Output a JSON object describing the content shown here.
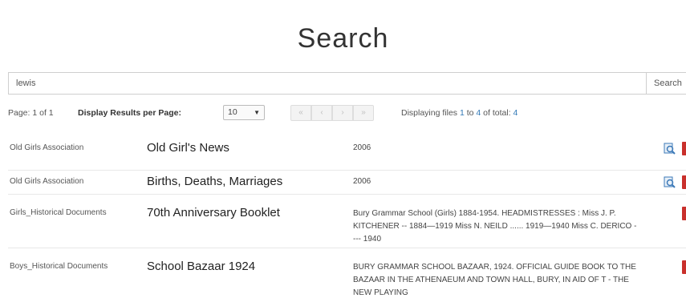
{
  "header": {
    "title": "Search"
  },
  "search": {
    "value": "lewis",
    "button_label": "Search"
  },
  "pagination": {
    "page_info": "Page: 1 of 1",
    "per_page_label": "Display Results per Page:",
    "per_page_value": "10",
    "first": "«",
    "prev": "‹",
    "next": "›",
    "last": "»",
    "displaying_prefix": "Displaying files",
    "displaying_from": "1",
    "displaying_to_word": "to",
    "displaying_to": "4",
    "displaying_of": "of total:",
    "displaying_total": "4"
  },
  "results": [
    {
      "category": "Old Girls Association",
      "title": "Old Girl's News",
      "description": "2006",
      "has_view": true,
      "has_pdf": true
    },
    {
      "category": "Old Girls Association",
      "title": "Births, Deaths, Marriages",
      "description": "2006",
      "has_view": true,
      "has_pdf": true
    },
    {
      "category": "Girls_Historical Documents",
      "title": "70th Anniversary Booklet",
      "description": "Bury Grammar School (Girls) 1884-1954. HEADMISTRESSES : Miss J. P. KITCHENER -- 1884—1919 Miss N. NEILD ...... 1919—1940 Miss C. DERICO ---- 1940",
      "has_view": false,
      "has_pdf": true
    },
    {
      "category": "Boys_Historical Documents",
      "title": "School Bazaar 1924",
      "description": "BURY GRAMMAR SCHOOL BAZAAR, 1924. OFFICIAL GUIDE BOOK TO THE BAZAAR IN THE ATHENAEUM AND TOWN HALL, BURY, IN AID OF T - THE NEW PLAYING",
      "has_view": false,
      "has_pdf": true
    }
  ],
  "colors": {
    "link": "#337ab7",
    "pdf": "#c9302c",
    "view": "#3d7ab8"
  },
  "icons": {
    "view": "magnifier-document-icon",
    "pdf": "pdf-file-icon"
  }
}
